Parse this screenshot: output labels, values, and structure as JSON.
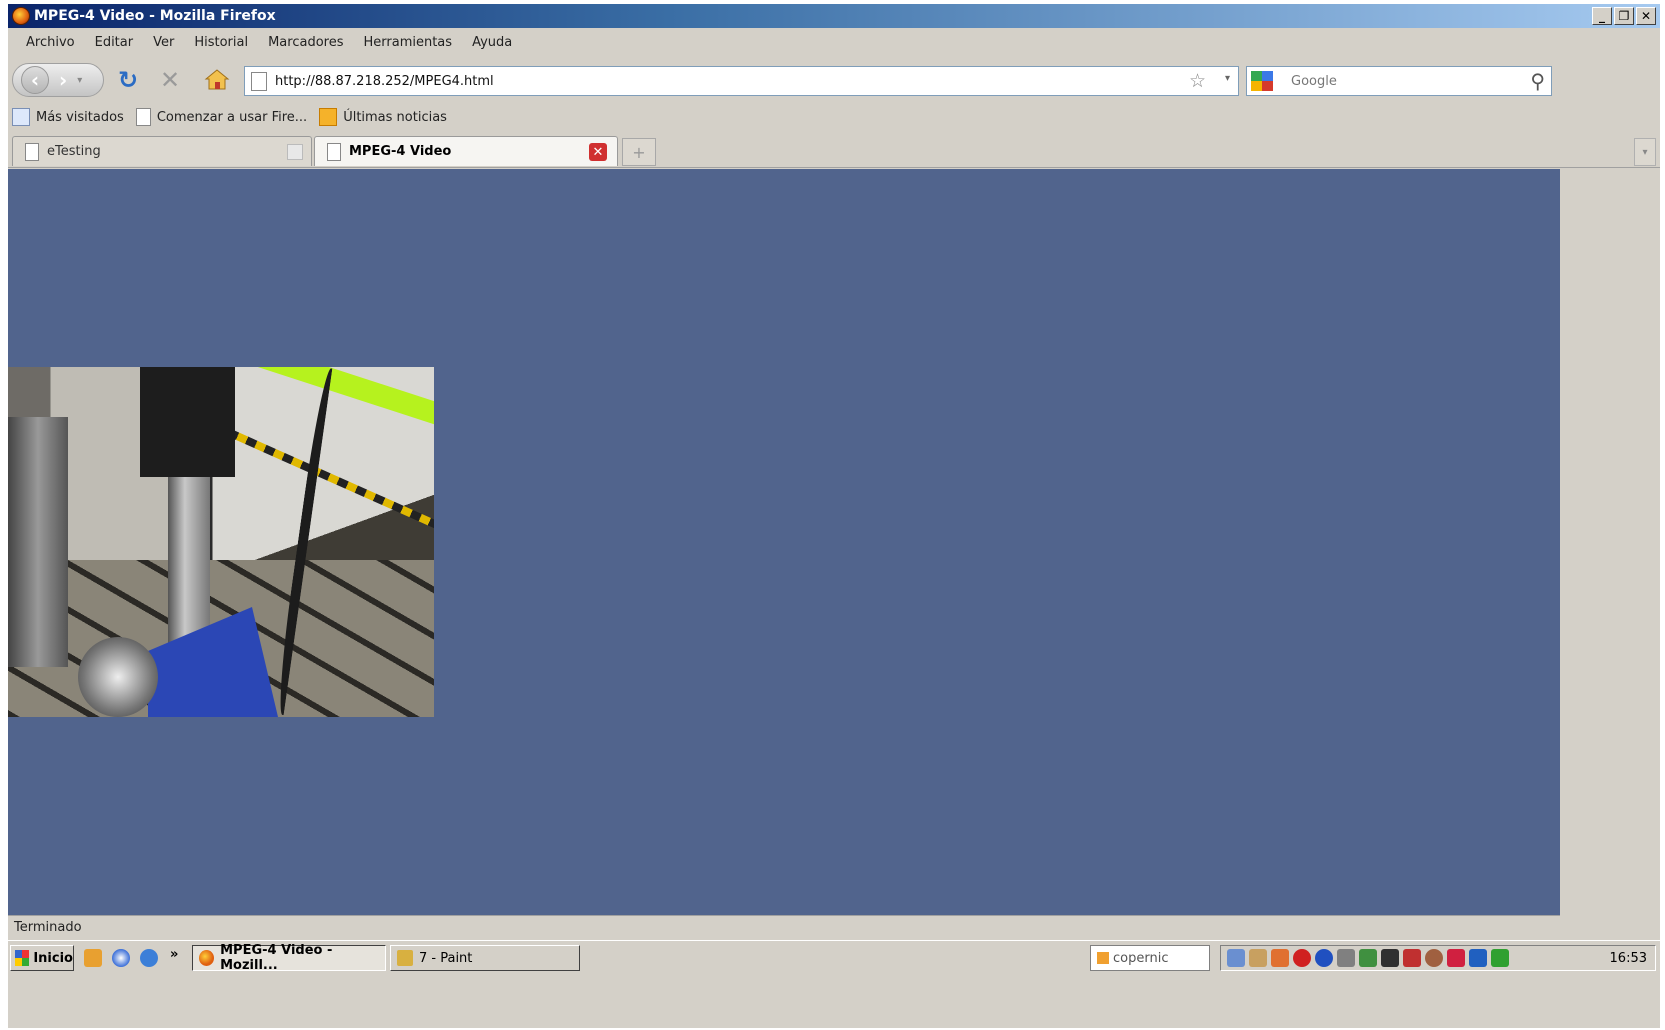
{
  "window": {
    "title": "MPEG-4 Video - Mozilla Firefox"
  },
  "menu": [
    "Archivo",
    "Editar",
    "Ver",
    "Historial",
    "Marcadores",
    "Herramientas",
    "Ayuda"
  ],
  "nav": {
    "url": "http://88.87.218.252/MPEG4.html",
    "search_placeholder": "Google"
  },
  "bookmarks": [
    "Más visitados",
    "Comenzar a usar Fire...",
    "Últimas noticias"
  ],
  "tabs": [
    {
      "label": "eTesting"
    },
    {
      "label": "MPEG-4 Video"
    }
  ],
  "status": "Terminado",
  "taskbar": {
    "start_label": "Inicio",
    "buttons": [
      "MPEG-4 Video - Mozill...",
      "7 - Paint"
    ],
    "search": "copernic",
    "clock": "16:53"
  },
  "colors": {
    "content_bg": "#51648d"
  }
}
